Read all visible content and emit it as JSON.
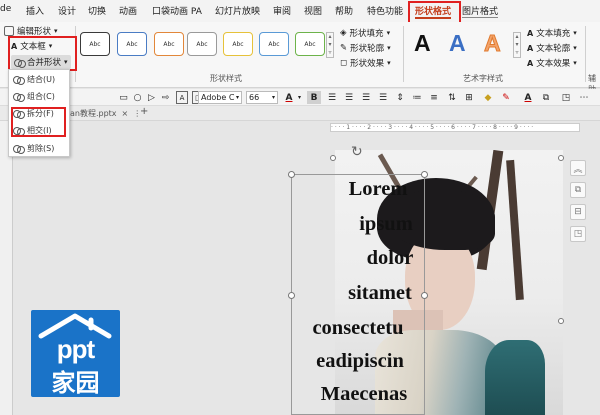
{
  "menu_tabs": [
    {
      "label": "de"
    },
    {
      "label": "插入"
    },
    {
      "label": "设计"
    },
    {
      "label": "切换"
    },
    {
      "label": "动画"
    },
    {
      "label": "口袋动画 PA"
    },
    {
      "label": "幻灯片放映"
    },
    {
      "label": "审阅"
    },
    {
      "label": "视图"
    },
    {
      "label": "帮助"
    },
    {
      "label": "特色功能"
    },
    {
      "label": "形状格式"
    },
    {
      "label": "图片格式"
    }
  ],
  "ribbon": {
    "insert_shapes": {
      "edit_shape": "编辑形状",
      "textbox": "文本框",
      "merge_shapes": "合并形状"
    },
    "shape_styles": {
      "style_label": "Abc",
      "fill": "形状填充",
      "outline": "形状轮廓",
      "effects": "形状效果",
      "group_label": "形状样式"
    },
    "wordart": {
      "letter": "A",
      "text_fill": "文本填充",
      "text_outline": "文本轮廓",
      "text_effects": "文本效果",
      "group_label": "艺术字样式"
    },
    "accessibility_cut": "辅助"
  },
  "format_toolbar": {
    "font_name": "Adobe C",
    "font_size": "66",
    "text_color_letter": "A",
    "bold": "B",
    "font_color_letter": "A"
  },
  "document_tab": {
    "filename": "an教程.pptx",
    "close": "×",
    "more": "⋮",
    "add": "+"
  },
  "merge_menu": {
    "items": [
      {
        "label": "结合(U)"
      },
      {
        "label": "组合(C)"
      },
      {
        "label": "拆分(F)"
      },
      {
        "label": "相交(I)"
      },
      {
        "label": "剪除(S)"
      }
    ]
  },
  "slide": {
    "text_lines": [
      "Lorem",
      "ipsum",
      "dolor",
      "sitamet",
      "consectetu",
      "eadipiscin",
      "Maecenas"
    ]
  },
  "ruler": {
    "ticks": "· · · · 1 · · · · 2 · · · · 3 · · · · 4 · · · · 5 · · · · 6 · · · · 7 · · · · 8 · · · · 9 · · · ·"
  },
  "side_panel": {
    "buttons": [
      "︽",
      "⧉",
      "⊟",
      "◳"
    ]
  },
  "logo": {
    "top": "ppt",
    "bottom": "家园"
  },
  "colors": {
    "accent": "#c43e1c",
    "highlight_box": "#e02020",
    "logo_bg": "#1a73c8"
  }
}
